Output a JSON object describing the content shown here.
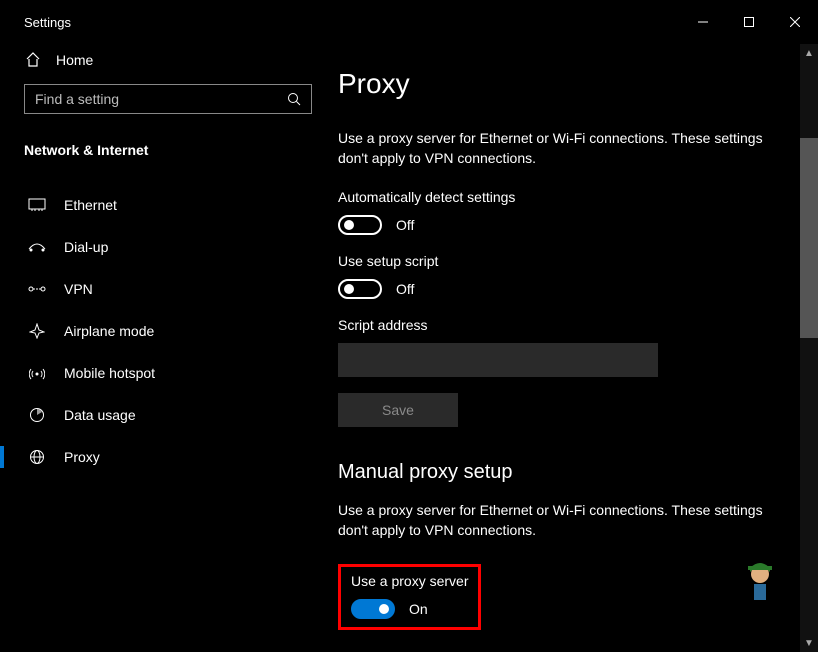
{
  "window": {
    "title": "Settings"
  },
  "sidebar": {
    "home": "Home",
    "search_placeholder": "Find a setting",
    "section": "Network & Internet",
    "items": [
      {
        "label": "Ethernet"
      },
      {
        "label": "Dial-up"
      },
      {
        "label": "VPN"
      },
      {
        "label": "Airplane mode"
      },
      {
        "label": "Mobile hotspot"
      },
      {
        "label": "Data usage"
      },
      {
        "label": "Proxy"
      }
    ]
  },
  "content": {
    "title": "Proxy",
    "description1": "Use a proxy server for Ethernet or Wi-Fi connections. These settings don't apply to VPN connections.",
    "auto_detect_label": "Automatically detect settings",
    "auto_detect_state": "Off",
    "setup_script_label": "Use setup script",
    "setup_script_state": "Off",
    "script_address_label": "Script address",
    "script_address_value": "",
    "save_button": "Save",
    "manual_heading": "Manual proxy setup",
    "description2": "Use a proxy server for Ethernet or Wi-Fi connections. These settings don't apply to VPN connections.",
    "use_proxy_label": "Use a proxy server",
    "use_proxy_state": "On"
  }
}
